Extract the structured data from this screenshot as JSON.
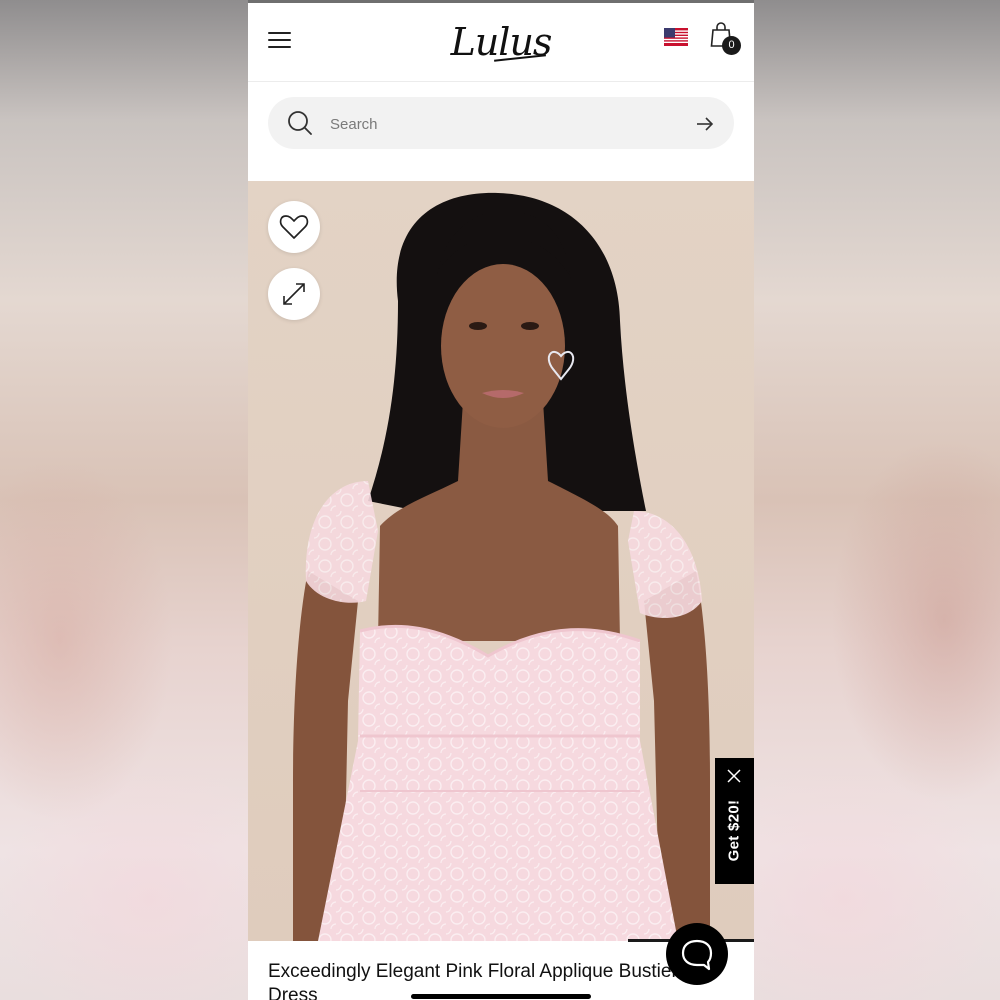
{
  "header": {
    "logo_text": "Lulus",
    "cart_count": "0",
    "menu_icon": "hamburger-menu-icon",
    "flag_icon": "us-flag-icon",
    "bag_icon": "shopping-bag-icon"
  },
  "search": {
    "placeholder": "Search",
    "value": "",
    "icon": "search-icon",
    "submit_icon": "arrow-right-icon"
  },
  "product": {
    "title": "Exceedingly Elegant Pink Floral Applique Bustier Midi Dress",
    "image_alt": "model wearing pink floral lace bustier dress"
  },
  "promo": {
    "label": "Get $20!",
    "close_icon": "close-icon"
  },
  "actions": {
    "wishlist_icon": "heart-icon",
    "expand_icon": "expand-icon",
    "chat_icon": "chat-bubble-icon"
  },
  "colors": {
    "hero_background": "#e1cfc0",
    "dress_pink": "#f5d5dc",
    "promo_background": "#000000",
    "chat_background": "#000000"
  }
}
